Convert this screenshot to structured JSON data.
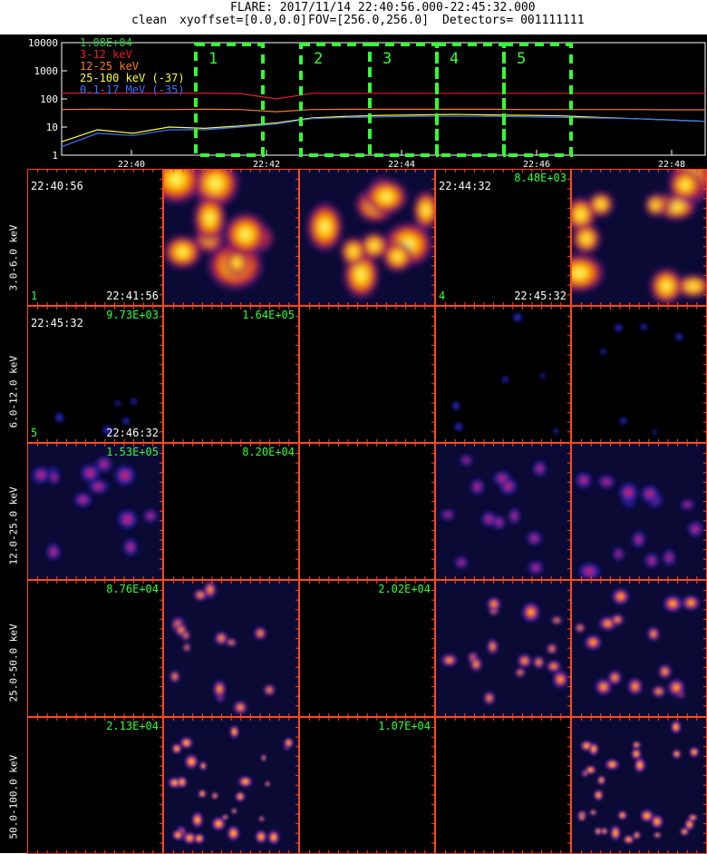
{
  "header": {
    "title": "FLARE: 2017/11/14 22:40:56.000-22:45:32.000",
    "method": "clean",
    "xyoffset": "xyoffset=[0.0,0.0]",
    "fov": "FOV=[256.0,256.0]",
    "detectors": "Detectors= 001111111"
  },
  "lightcurve": {
    "y_ticks": [
      "10000",
      "1000",
      "100",
      "10",
      "1"
    ],
    "x_ticks": [
      "22:40",
      "22:42",
      "22:44",
      "22:46",
      "22:48"
    ],
    "legend": [
      {
        "label": "1.08E+04",
        "color": "#2ecc40"
      },
      {
        "label": "3-12 keV",
        "color": "#e8192c"
      },
      {
        "label": "12-25 keV",
        "color": "#ff7a1a"
      },
      {
        "label": "25-100 keV (-37)",
        "color": "#ffff33"
      },
      {
        "label": "0.1-17 MeV (-35)",
        "color": "#3a73ff"
      }
    ],
    "intervals": [
      "1",
      "2",
      "3",
      "4",
      "5"
    ],
    "colors": {
      "box": "#33ff33",
      "axis": "#ffffff"
    }
  },
  "chart_data": {
    "type": "line",
    "x_axis_labels": [
      "22:40",
      "22:42",
      "22:44",
      "22:46",
      "22:48"
    ],
    "y_scale": "log",
    "ylim": [
      1,
      10000
    ],
    "series": [
      {
        "name": "3-12 keV",
        "values": [
          160,
          160,
          160,
          160,
          160,
          155,
          100,
          158,
          158,
          158,
          158,
          158,
          158,
          158,
          158,
          158,
          158,
          158,
          158
        ]
      },
      {
        "name": "12-25 keV",
        "values": [
          42,
          43,
          42,
          42,
          43,
          42,
          35,
          42,
          43,
          43,
          43,
          43,
          43,
          42,
          42,
          42,
          42,
          41,
          41
        ]
      },
      {
        "name": "25-100 keV (-37)",
        "values": [
          3,
          8,
          6,
          10,
          9,
          11,
          14,
          21,
          24,
          26,
          27,
          28,
          27,
          26,
          25,
          22,
          20,
          18,
          16
        ]
      },
      {
        "name": "0.1-17 MeV (-35)",
        "values": [
          2,
          6,
          5,
          8,
          8,
          10,
          13,
          20,
          22,
          23,
          24,
          24,
          24,
          23,
          22,
          21,
          20,
          18,
          16
        ]
      }
    ]
  },
  "rows": [
    {
      "label": "3.0-6.0 keV",
      "panels": [
        {
          "tl": "22:40:56",
          "tr": "",
          "bl": "1",
          "br": "22:41:56",
          "img": "black"
        },
        {
          "tl": "",
          "tr": "",
          "bl": "",
          "br": "",
          "img": "hotA"
        },
        {
          "tl": "",
          "tr": "",
          "bl": "",
          "br": "",
          "img": "hotB"
        },
        {
          "tl": "22:44:32",
          "tr": "8.48E+03",
          "bl": "4",
          "br": "22:45:32",
          "img": "black"
        },
        {
          "tl": "",
          "tr": "",
          "bl": "",
          "br": "",
          "img": "hotC"
        }
      ]
    },
    {
      "label": "6.0-12.0 keV",
      "panels": [
        {
          "tl": "22:45:32",
          "tr": "9.73E+03",
          "bl": "5",
          "br": "22:46:32",
          "img": "blueA"
        },
        {
          "tl": "",
          "tr": "1.64E+05",
          "bl": "",
          "br": "",
          "img": "black"
        },
        {
          "tl": "",
          "tr": "",
          "bl": "",
          "br": "",
          "img": "black"
        },
        {
          "tl": "",
          "tr": "",
          "bl": "",
          "br": "",
          "img": "blueB"
        },
        {
          "tl": "",
          "tr": "",
          "bl": "",
          "br": "",
          "img": "blueC"
        }
      ]
    },
    {
      "label": "12.0-25.0 keV",
      "panels": [
        {
          "tl": "",
          "tr": "1.53E+05",
          "bl": "",
          "br": "",
          "img": "redA"
        },
        {
          "tl": "",
          "tr": "8.20E+04",
          "bl": "",
          "br": "",
          "img": "black"
        },
        {
          "tl": "",
          "tr": "",
          "bl": "",
          "br": "",
          "img": "black"
        },
        {
          "tl": "",
          "tr": "",
          "bl": "",
          "br": "",
          "img": "redB"
        },
        {
          "tl": "",
          "tr": "",
          "bl": "",
          "br": "",
          "img": "redC"
        }
      ]
    },
    {
      "label": "25.0-50.0 keV",
      "panels": [
        {
          "tl": "",
          "tr": "8.76E+04",
          "bl": "",
          "br": "",
          "img": "black"
        },
        {
          "tl": "",
          "tr": "",
          "bl": "",
          "br": "",
          "img": "ringA"
        },
        {
          "tl": "",
          "tr": "2.02E+04",
          "bl": "",
          "br": "",
          "img": "black"
        },
        {
          "tl": "",
          "tr": "",
          "bl": "",
          "br": "",
          "img": "ringB"
        },
        {
          "tl": "",
          "tr": "",
          "bl": "",
          "br": "",
          "img": "ringC"
        }
      ]
    },
    {
      "label": "50.0-100.0 keV",
      "panels": [
        {
          "tl": "",
          "tr": "2.13E+04",
          "bl": "",
          "br": "",
          "img": "black"
        },
        {
          "tl": "",
          "tr": "",
          "bl": "",
          "br": "",
          "img": "noiseA"
        },
        {
          "tl": "",
          "tr": "1.07E+04",
          "bl": "",
          "br": "",
          "img": "black"
        },
        {
          "tl": "",
          "tr": "",
          "bl": "",
          "br": "",
          "img": "black"
        },
        {
          "tl": "",
          "tr": "",
          "bl": "",
          "br": "",
          "img": "noiseB"
        }
      ]
    }
  ],
  "colors": {
    "label_green": "#33ff33",
    "label_white": "#ffffff",
    "panel_border": "#ff4a1a"
  }
}
